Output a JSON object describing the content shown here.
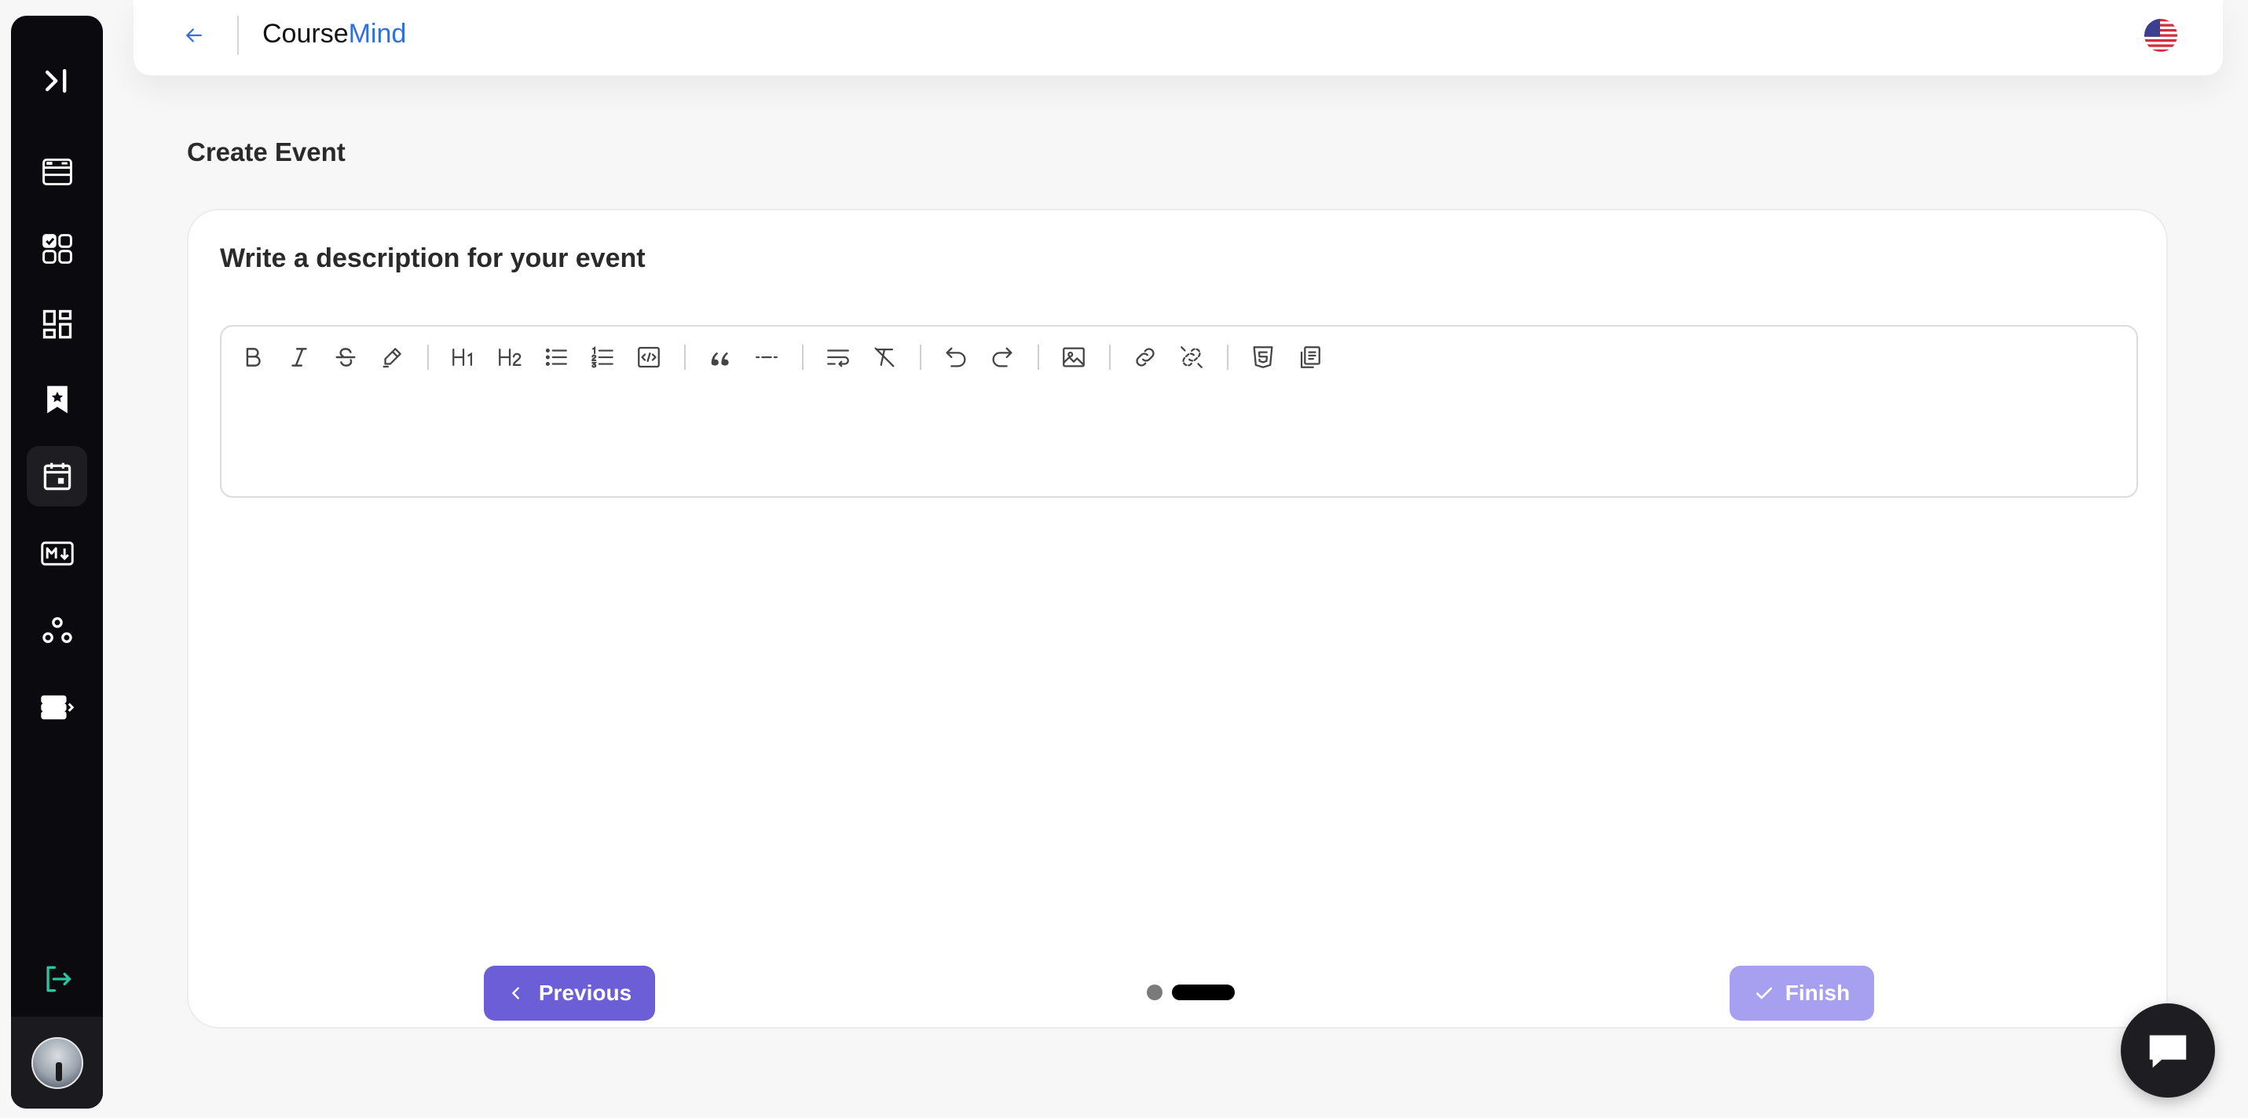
{
  "app": {
    "brand_prefix": "Course",
    "brand_accent": "Mind"
  },
  "sidebar": {
    "items": [
      {
        "icon": "expand-sidebar-icon"
      },
      {
        "icon": "courses-list-icon"
      },
      {
        "icon": "tasks-grid-icon"
      },
      {
        "icon": "dashboard-icon"
      },
      {
        "icon": "bookmark-star-icon"
      },
      {
        "icon": "calendar-event-icon",
        "active": true
      },
      {
        "icon": "markdown-icon"
      },
      {
        "icon": "community-icon"
      },
      {
        "icon": "server-list-icon"
      },
      {
        "icon": "logout-icon"
      }
    ]
  },
  "page": {
    "title": "Create Event",
    "card_heading": "Write a description for your event"
  },
  "editor": {
    "toolbar": [
      "bold",
      "italic",
      "strikethrough",
      "highlight",
      "heading-1",
      "heading-2",
      "bullet-list",
      "ordered-list",
      "code-block",
      "blockquote",
      "horizontal-rule",
      "hard-break",
      "clear-format",
      "undo",
      "redo",
      "image",
      "link",
      "unlink",
      "html",
      "copy"
    ],
    "content": ""
  },
  "wizard": {
    "previous_label": "Previous",
    "finish_label": "Finish",
    "steps_total": 2,
    "current_step": 2
  },
  "colors": {
    "sidebar_bg": "#0b0b0f",
    "accent_blue": "#2f6fe4",
    "primary_purple": "#6c5ed6",
    "disabled_purple": "#a79ff0",
    "logout_teal": "#2cc4a0"
  }
}
